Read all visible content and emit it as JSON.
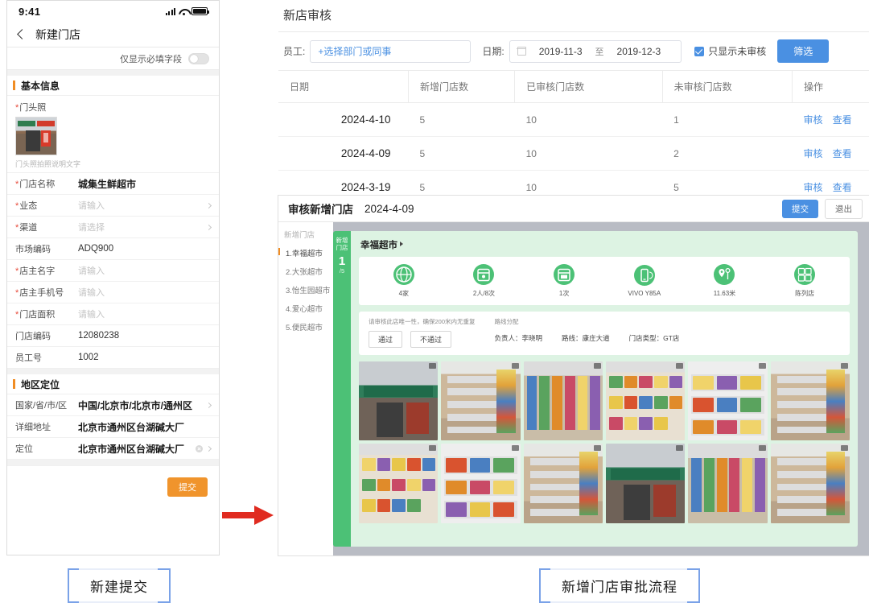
{
  "phone": {
    "status": {
      "time": "9:41",
      "signal_icon": "signal-bars-icon",
      "wifi_icon": "wifi-icon",
      "battery_icon": "battery-icon"
    },
    "nav": {
      "back_icon": "back-chevron-icon",
      "title": "新建门店"
    },
    "toggle_row": {
      "label": "仅显示必填字段",
      "state": "off"
    },
    "sections": [
      {
        "title": "基本信息"
      },
      {
        "title": "地区定位"
      }
    ],
    "photo_field": {
      "label": "门头照",
      "required": true,
      "caption": "门头照拍照说明文字"
    },
    "basic_fields": [
      {
        "label": "门店名称",
        "required": true,
        "value": "城集生鲜超市",
        "style": "bold",
        "chevron": false
      },
      {
        "label": "业态",
        "required": true,
        "value": "请输入",
        "style": "placeholder",
        "chevron": true
      },
      {
        "label": "渠道",
        "required": true,
        "value": "请选择",
        "style": "placeholder",
        "chevron": true
      },
      {
        "label": "市场编码",
        "required": false,
        "value": "ADQ900",
        "style": "plain",
        "chevron": false
      },
      {
        "label": "店主名字",
        "required": true,
        "value": "请输入",
        "style": "placeholder",
        "chevron": false
      },
      {
        "label": "店主手机号",
        "required": true,
        "value": "请输入",
        "style": "placeholder",
        "chevron": false
      },
      {
        "label": "门店面积",
        "required": true,
        "value": "请输入",
        "style": "placeholder",
        "chevron": false
      },
      {
        "label": "门店编码",
        "required": false,
        "value": "12080238",
        "style": "plain",
        "chevron": false
      },
      {
        "label": "员工号",
        "required": false,
        "value": "1002",
        "style": "plain",
        "chevron": false
      }
    ],
    "region_fields": [
      {
        "label": "国家/省/市/区",
        "required": false,
        "value": "中国/北京市/北京市/通州区",
        "style": "bold",
        "chevron": true
      },
      {
        "label": "详细地址",
        "required": false,
        "value": "北京市通州区台湖碱大厂",
        "style": "bold",
        "chevron": false
      },
      {
        "label": "定位",
        "required": false,
        "value": "北京市通州区台湖碱大厂",
        "style": "bold",
        "chevron": true,
        "clear": true
      }
    ],
    "submit_label": "提交"
  },
  "arrow": {
    "icon": "right-arrow-icon",
    "color": "#e02b20"
  },
  "right": {
    "page_title": "新店审核",
    "filter": {
      "employee_label": "员工:",
      "employee_placeholder": "+选择部门或同事",
      "date_label": "日期:",
      "calendar_icon": "calendar-icon",
      "date_start": "2019-11-3",
      "date_sep": "至",
      "date_end": "2019-12-3",
      "checkbox_label": "只显示未审核",
      "checkbox_checked": true,
      "filter_button": "筛选",
      "accent": "#4a90e2"
    },
    "table": {
      "columns": [
        "日期",
        "新增门店数",
        "已审核门店数",
        "未审核门店数",
        "操作"
      ],
      "rows": [
        {
          "date": "2024-4-10",
          "new": "5",
          "reviewed": "10",
          "pending": "1",
          "actions": [
            "审核",
            "查看"
          ]
        },
        {
          "date": "2024-4-09",
          "new": "5",
          "reviewed": "10",
          "pending": "2",
          "actions": [
            "审核",
            "查看"
          ]
        },
        {
          "date": "2024-3-19",
          "new": "5",
          "reviewed": "10",
          "pending": "5",
          "actions": [
            "审核",
            "查看"
          ]
        }
      ]
    }
  },
  "modal": {
    "title": "审核新增门店",
    "date": "2024-4-09",
    "submit_label": "提交",
    "exit_label": "退出",
    "store_list": {
      "header": "新增门店",
      "items": [
        "1.幸福超市",
        "2.大张超市",
        "3.怡生园超市",
        "4.爱心超市",
        "5.便民超市"
      ],
      "active_index": 0
    },
    "badge": {
      "line1": "新增",
      "line2": "门店",
      "number": "1",
      "denominator": "/5"
    },
    "store_name": "幸福超市",
    "stats": [
      {
        "icon": "globe-icon",
        "label": "4家"
      },
      {
        "icon": "calendar-person-icon",
        "label": "2人/8次"
      },
      {
        "icon": "calendar-visit-icon",
        "label": "1次"
      },
      {
        "icon": "phone-device-icon",
        "label": "VIVO Y85A"
      },
      {
        "icon": "location-pin-icon",
        "label": "11.63米"
      },
      {
        "icon": "store-grid-icon",
        "label": "陈列店"
      }
    ],
    "approve": {
      "note": "请审核此店唯一性，确保200米内无重复",
      "pass_label": "通过",
      "fail_label": "不通过",
      "route_title": "路线分配",
      "meta": [
        {
          "label": "负责人：",
          "value": "李晓明"
        },
        {
          "label": "路线：",
          "value": "康庄大道"
        },
        {
          "label": "门店类型：",
          "value": "GT店"
        }
      ]
    },
    "photos": [
      {
        "type": "store",
        "watermark": true
      },
      {
        "type": "aisle",
        "watermark": true
      },
      {
        "type": "cool",
        "watermark": true
      },
      {
        "type": "snack",
        "watermark": true
      },
      {
        "type": "box",
        "watermark": true
      },
      {
        "type": "aisle",
        "watermark": true
      },
      {
        "type": "snack",
        "watermark": true
      },
      {
        "type": "box",
        "watermark": true
      },
      {
        "type": "aisle",
        "watermark": true
      },
      {
        "type": "store",
        "watermark": true
      },
      {
        "type": "cool",
        "watermark": true
      },
      {
        "type": "aisle",
        "watermark": true
      }
    ]
  },
  "captions": {
    "left": "新建提交",
    "right": "新增门店审批流程"
  }
}
